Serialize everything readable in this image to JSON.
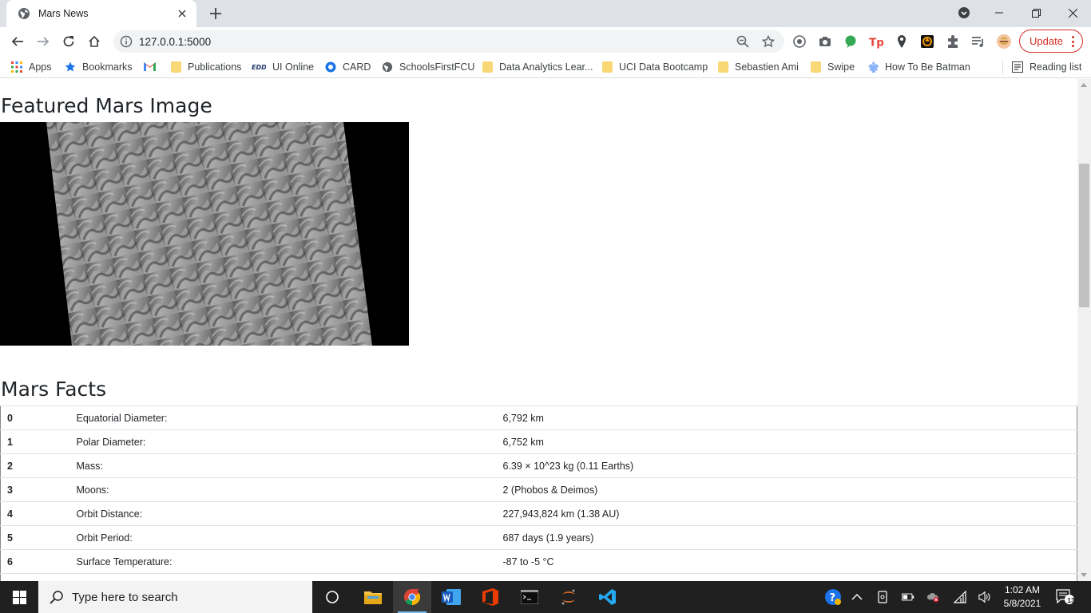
{
  "browser": {
    "tab_title": "Mars News",
    "url": "127.0.0.1:5000",
    "update_label": "Update"
  },
  "bookmarks": [
    {
      "label": "Apps",
      "icon": "apps-grid-icon"
    },
    {
      "label": "Bookmarks",
      "icon": "star-icon"
    },
    {
      "label": "",
      "icon": "gmail-icon"
    },
    {
      "label": "Publications",
      "icon": "folder-icon"
    },
    {
      "label": "UI Online",
      "icon": "edd-icon"
    },
    {
      "label": "CARD",
      "icon": "card-icon"
    },
    {
      "label": "SchoolsFirstFCU",
      "icon": "globe-icon"
    },
    {
      "label": "Data Analytics Lear...",
      "icon": "folder-icon"
    },
    {
      "label": "UCI Data Bootcamp",
      "icon": "folder-icon"
    },
    {
      "label": "Sebastien Ami",
      "icon": "folder-icon"
    },
    {
      "label": "Swipe",
      "icon": "folder-icon"
    },
    {
      "label": "How To Be Batman",
      "icon": "batman-icon"
    },
    {
      "label": "Reading list",
      "icon": "reading-list-icon"
    }
  ],
  "page": {
    "featured_heading": "Featured Mars Image",
    "facts_heading": "Mars Facts",
    "facts": [
      {
        "index": "0",
        "label": "Equatorial Diameter:",
        "value": "6,792 km"
      },
      {
        "index": "1",
        "label": "Polar Diameter:",
        "value": "6,752 km"
      },
      {
        "index": "2",
        "label": "Mass:",
        "value": "6.39 × 10^23 kg (0.11 Earths)"
      },
      {
        "index": "3",
        "label": "Moons:",
        "value": "2 (Phobos & Deimos)"
      },
      {
        "index": "4",
        "label": "Orbit Distance:",
        "value": "227,943,824 km (1.38 AU)"
      },
      {
        "index": "5",
        "label": "Orbit Period:",
        "value": "687 days (1.9 years)"
      },
      {
        "index": "6",
        "label": "Surface Temperature:",
        "value": "-87 to -5 °C"
      }
    ]
  },
  "taskbar": {
    "search_placeholder": "Type here to search",
    "time": "1:02 AM",
    "date": "5/8/2021",
    "notification_count": "13"
  },
  "colors": {
    "tabstrip": "#dee1e6",
    "update_red": "#d93025",
    "taskbar": "#202020"
  }
}
